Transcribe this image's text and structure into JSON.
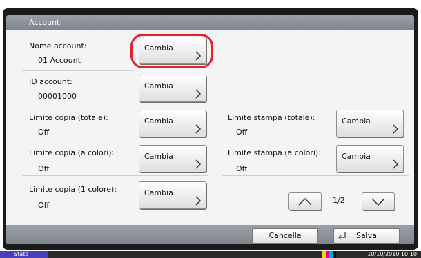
{
  "header": {
    "title": "Account:"
  },
  "rows": {
    "nome_account": {
      "label": "Nome account:",
      "value": "01 Account",
      "button": "Cambia"
    },
    "id_account": {
      "label": "ID account:",
      "value": "00001000",
      "button": "Cambia"
    },
    "limite_copia_totale": {
      "label": "Limite copia (totale):",
      "value": "Off",
      "button": "Cambia"
    },
    "limite_stampa_totale": {
      "label": "Limite stampa (totale):",
      "value": "Off",
      "button": "Cambia"
    },
    "limite_copia_colori": {
      "label": "Limite copia (a colori):",
      "value": "Off",
      "button": "Cambia"
    },
    "limite_stampa_colori": {
      "label": "Limite stampa (a colori):",
      "value": "Off",
      "button": "Cambia"
    },
    "limite_copia_1colore": {
      "label": "Limite copia (1 colore):",
      "value": "Off",
      "button": "Cambia"
    }
  },
  "pager": {
    "page": "1/2",
    "up_icon": "chevron-up-icon",
    "down_icon": "chevron-down-icon"
  },
  "footer": {
    "cancel": "Cancella",
    "save": "Salva",
    "save_icon": "enter-arrow-icon"
  },
  "statusbar": {
    "status": "Stato",
    "datetime": "10/10/2010  10:10"
  },
  "colors": {
    "highlight": "#e4202a",
    "status_tab": "#4a3fb8"
  }
}
